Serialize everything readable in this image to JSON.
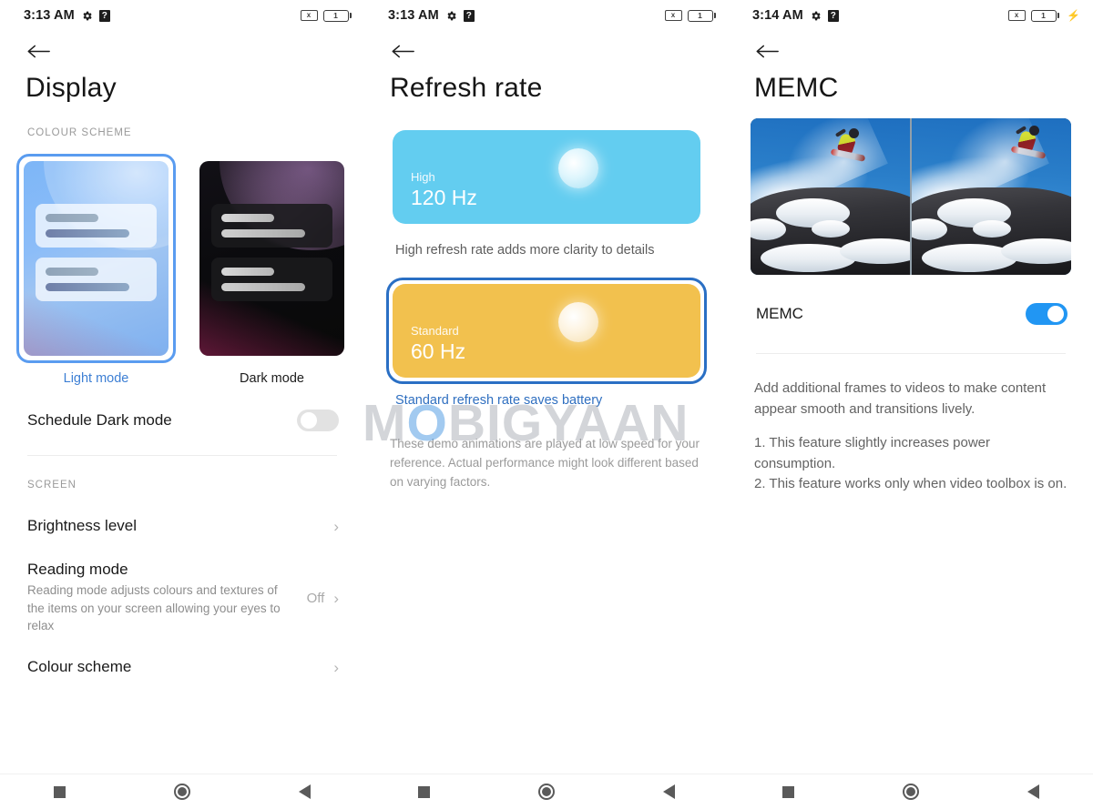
{
  "screens": [
    {
      "statusbar": {
        "time": "3:13 AM",
        "gear_icon": "gear-icon",
        "help_icon": "?",
        "mute_icon": "x",
        "battery_level": "1",
        "charging": false
      },
      "title": "Display",
      "section_label": "COLOUR SCHEME",
      "themes": [
        {
          "caption": "Light mode",
          "selected": true
        },
        {
          "caption": "Dark mode",
          "selected": false
        }
      ],
      "schedule": {
        "label": "Schedule Dark mode",
        "toggle_on": false
      },
      "screen_section_label": "SCREEN",
      "rows": [
        {
          "title": "Brightness level",
          "sub": "",
          "value": "",
          "chevron": "›"
        },
        {
          "title": "Reading mode",
          "sub": "Reading mode adjusts colours and textures of the items on your screen allowing your eyes to relax",
          "value": "Off",
          "chevron": "›"
        },
        {
          "title": "Colour scheme",
          "sub": "",
          "value": "",
          "chevron": "›"
        }
      ]
    },
    {
      "statusbar": {
        "time": "3:13 AM",
        "gear_icon": "gear-icon",
        "help_icon": "?",
        "mute_icon": "x",
        "battery_level": "1",
        "charging": false
      },
      "title": "Refresh rate",
      "cards": [
        {
          "label": "High",
          "rate": "120 Hz",
          "selected": false,
          "note": "High refresh rate adds more clarity to details",
          "note_is_link": false
        },
        {
          "label": "Standard",
          "rate": "60 Hz",
          "selected": true,
          "note": "Standard refresh rate saves battery",
          "note_is_link": true
        }
      ],
      "footer": "These demo animations are played at low speed for your reference. Actual performance might look different based on varying factors."
    },
    {
      "statusbar": {
        "time": "3:14 AM",
        "gear_icon": "gear-icon",
        "help_icon": "?",
        "mute_icon": "x",
        "battery_level": "1",
        "charging": true
      },
      "title": "MEMC",
      "preview_alt": "snowboarder-comparison-image",
      "memc": {
        "label": "MEMC",
        "toggle_on": true
      },
      "description": [
        "Add additional frames to videos to make content appear smooth and transitions lively.",
        "1. This feature slightly increases power consumption.\n2. This feature works only when video toolbox is on."
      ]
    }
  ],
  "watermark": {
    "before": "M",
    "o": "O",
    "after": "BIGYAAN"
  },
  "navbar": {
    "recent": "square-icon",
    "home": "circle-icon",
    "back": "triangle-back-icon"
  },
  "colors": {
    "accent_blue": "#2196f3",
    "selected_border": "#5a9cf0",
    "high_card": "#63cdf0",
    "standard_card": "#f2c14e",
    "link_blue": "#2f6fc0"
  }
}
